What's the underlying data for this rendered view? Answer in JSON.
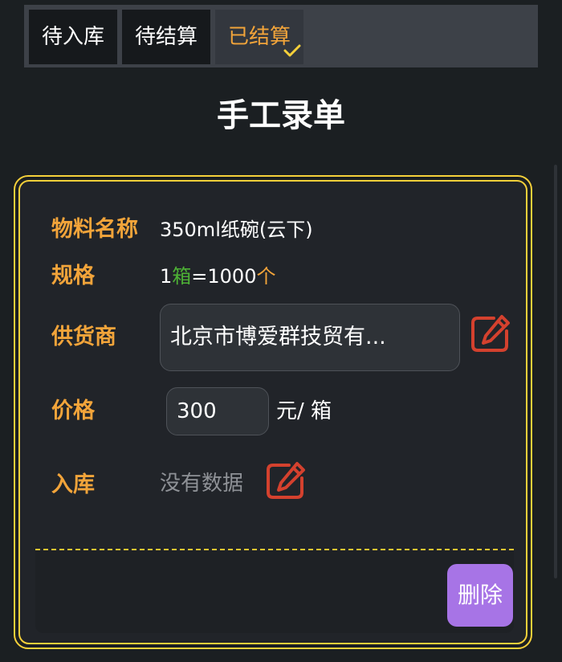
{
  "tabs": [
    {
      "label": "待入库"
    },
    {
      "label": "待结算"
    },
    {
      "label": "已结算",
      "active": true
    }
  ],
  "page_title": "手工录单",
  "material": {
    "label": "物料名称",
    "value": "350ml纸碗(云下)"
  },
  "spec": {
    "label": "规格",
    "qty1": "1",
    "unit1": "箱",
    "equals": "=1000",
    "unit2": "个"
  },
  "supplier": {
    "label": "供货商",
    "value": "北京市博爱群技贸有..."
  },
  "price": {
    "label": "价格",
    "value": "300",
    "unit": "元/ 箱"
  },
  "stock_in": {
    "label": "入库",
    "value": "没有数据"
  },
  "delete_label": "删除",
  "colors": {
    "accent": "#f2a43a",
    "border": "#f5d03a",
    "edit_icon": "#d4412e",
    "delete_button": "#a774e6",
    "background": "#1b1f22"
  },
  "icons": [
    "check-icon",
    "edit-icon"
  ]
}
